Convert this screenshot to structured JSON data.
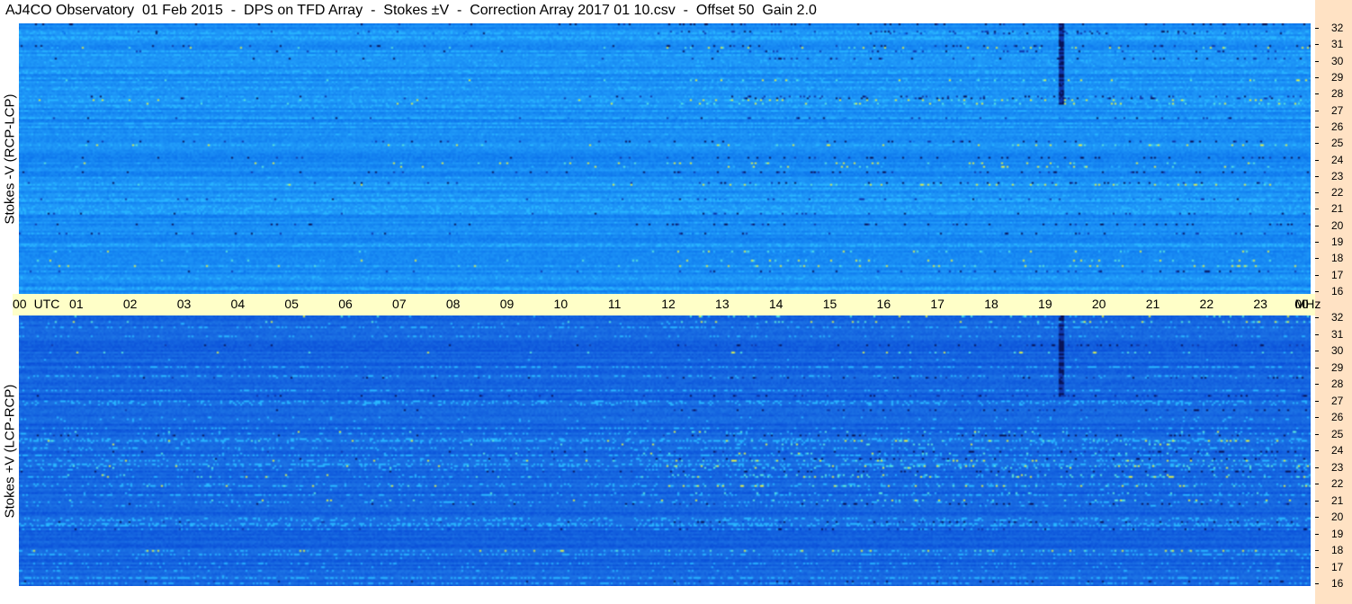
{
  "title": "AJ4CO Observatory  01 Feb 2015  -  DPS on TFD Array  -  Stokes ±V  -  Correction Array 2017 01 10.csv  -  Offset 50  Gain 2.0",
  "panels": [
    {
      "label": "Stokes -V (RCP-LCP)",
      "base_color": "#1a8ff5"
    },
    {
      "label": "Stokes +V (LCP-RCP)",
      "base_color": "#1565e0"
    }
  ],
  "time_axis": {
    "labels": [
      "00",
      "UTC",
      "01",
      "02",
      "03",
      "04",
      "05",
      "06",
      "07",
      "08",
      "09",
      "10",
      "11",
      "12",
      "13",
      "14",
      "15",
      "16",
      "17",
      "18",
      "19",
      "20",
      "21",
      "22",
      "23",
      "00",
      "MHz"
    ],
    "background": "#ffffc8"
  },
  "freq_axis": {
    "labels": [
      "32",
      "31",
      "30",
      "29",
      "28",
      "27",
      "26",
      "25",
      "24",
      "23",
      "22",
      "21",
      "20",
      "19",
      "18",
      "17",
      "16"
    ],
    "background": "#ffe2c4"
  },
  "chart_data": {
    "type": "heatmap",
    "title": "AJ4CO Observatory  01 Feb 2015  -  DPS on TFD Array  -  Stokes ±V  -  Correction Array 2017 01 10.csv  -  Offset 50  Gain 2.0",
    "x_label": "UTC",
    "y_label": "MHz",
    "x_range_hours": [
      0,
      24
    ],
    "y_range_mhz": [
      16,
      32
    ],
    "series": [
      {
        "name": "Stokes -V (RCP-LCP)"
      },
      {
        "name": "Stokes +V (LCP-RCP)"
      }
    ],
    "colormap": [
      "#0a2a9a",
      "#1565e0",
      "#1a8ff5",
      "#2ab8ff",
      "#5fe8d8",
      "#d8f060",
      "#ff60c0"
    ]
  }
}
